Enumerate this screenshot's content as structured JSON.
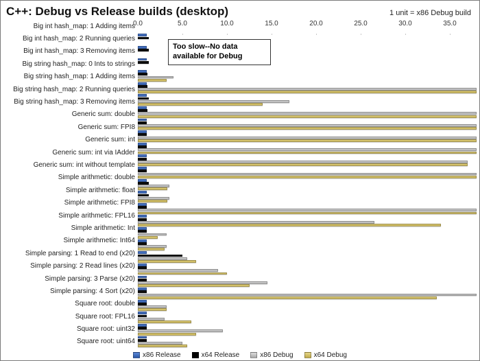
{
  "title": "C++: Debug vs Release builds (desktop)",
  "subtitle": "1 unit = x86 Debug build",
  "note": "Too slow--No data available for Debug",
  "legend": [
    "x86 Release",
    "x64 Release",
    "x86 Debug",
    "x64 Debug"
  ],
  "chart_data": {
    "type": "bar",
    "xlabel": "",
    "ylabel": "",
    "xlim": [
      0,
      38
    ],
    "ticks": [
      0.0,
      5.0,
      10.0,
      15.0,
      20.0,
      25.0,
      30.0,
      35.0
    ],
    "series_names": [
      "x86 Release",
      "x64 Release",
      "x86 Debug",
      "x64 Debug"
    ],
    "categories": [
      "Big int hash_map: 1 Adding items",
      "Big int hash_map: 2 Running queries",
      "Big int hash_map: 3 Removing items",
      "Big string hash_map: 0 Ints to strings",
      "Big string hash_map: 1 Adding items",
      "Big string hash_map: 2 Running queries",
      "Big string hash_map: 3 Removing items",
      "Generic sum: double",
      "Generic sum: FPI8",
      "Generic sum: int",
      "Generic sum: int via IAdder",
      "Generic sum: int without template",
      "Simple arithmetic: double",
      "Simple arithmetic: float",
      "Simple arithmetic: FPI8",
      "Simple arithmetic: FPL16",
      "Simple arithmetic: Int",
      "Simple arithmetic: Int64",
      "Simple parsing: 1 Read to end (x20)",
      "Simple parsing: 2 Read lines (x20)",
      "Simple parsing: 3 Parse (x20)",
      "Simple parsing: 4 Sort (x20)",
      "Square root: double",
      "Square root: FPL16",
      "Square root: uint32",
      "Square root: uint64"
    ],
    "series": [
      {
        "name": "x86 Release",
        "values": [
          1.0,
          1.0,
          1.0,
          1.0,
          1.0,
          1.0,
          1.0,
          1.0,
          1.0,
          1.0,
          1.0,
          1.0,
          1.0,
          1.0,
          1.0,
          1.0,
          1.0,
          1.0,
          1.0,
          1.0,
          1.0,
          1.0,
          1.0,
          1.0,
          1.0,
          1.0
        ]
      },
      {
        "name": "x64 Release",
        "values": [
          1.2,
          1.2,
          1.2,
          1.1,
          1.1,
          1.2,
          1.1,
          1.0,
          1.0,
          1.0,
          1.0,
          1.0,
          1.2,
          1.2,
          1.0,
          1.0,
          1.0,
          1.0,
          5.0,
          1.0,
          1.0,
          1.0,
          1.0,
          1.0,
          1.0,
          1.0
        ]
      },
      {
        "name": "x86 Debug",
        "values": [
          null,
          null,
          null,
          4.0,
          60.0,
          17.0,
          60.0,
          60.0,
          60.0,
          60.0,
          37.0,
          60.0,
          3.5,
          3.5,
          60.0,
          26.5,
          3.2,
          3.2,
          5.5,
          9.0,
          14.5,
          60.0,
          3.2,
          3.0,
          9.5,
          5.0
        ]
      },
      {
        "name": "x64 Debug",
        "values": [
          null,
          null,
          null,
          3.2,
          60.0,
          14.0,
          60.0,
          60.0,
          60.0,
          60.0,
          37.0,
          60.0,
          3.3,
          3.3,
          60.0,
          34.0,
          2.2,
          3.0,
          6.5,
          10.0,
          12.5,
          33.5,
          3.2,
          6.0,
          6.5,
          5.5
        ]
      }
    ]
  }
}
